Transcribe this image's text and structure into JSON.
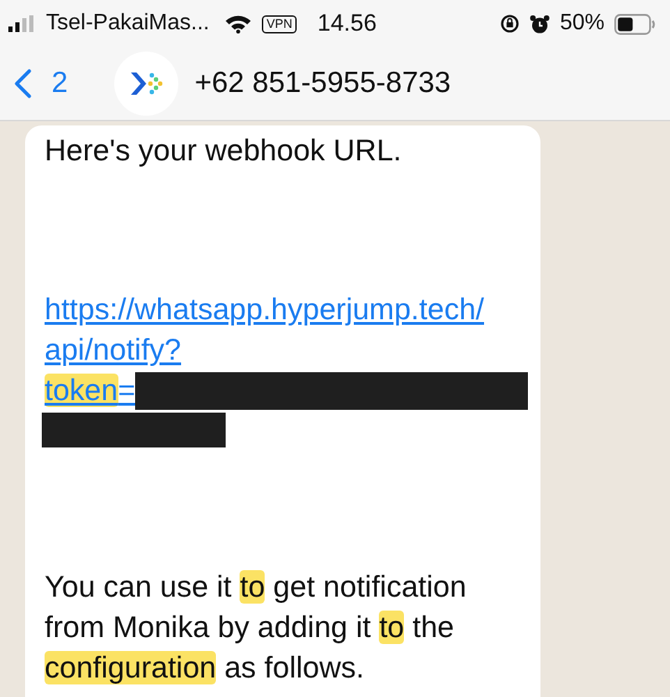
{
  "status_bar": {
    "carrier": "Tsel-PakaiMas...",
    "vpn": "VPN",
    "time": "14.56",
    "battery": "50%"
  },
  "header": {
    "back_count": "2",
    "title": "+62 851-5955-8733"
  },
  "message": {
    "paragraphs": [
      {
        "kind": "text",
        "segments": [
          {
            "text": "Here's your webhook URL.",
            "highlighted": false
          }
        ]
      },
      {
        "kind": "link",
        "lines": [
          [
            {
              "text": "https://whatsapp.hyperjump.tech/",
              "highlighted": false
            }
          ],
          [
            {
              "text": "api/notify?",
              "highlighted": false
            }
          ],
          [
            {
              "text": "token",
              "highlighted": true
            },
            {
              "text": "=",
              "highlighted": false
            }
          ]
        ]
      },
      {
        "kind": "text",
        "segments": [
          {
            "text": "You can use it ",
            "highlighted": false
          },
          {
            "text": "to",
            "highlighted": true
          },
          {
            "text": " get notification from Monika by adding it ",
            "highlighted": false
          },
          {
            "text": "to",
            "highlighted": true
          },
          {
            "text": " the ",
            "highlighted": false
          },
          {
            "text": "configuration",
            "highlighted": true
          },
          {
            "text": " as follows.",
            "highlighted": false
          }
        ]
      }
    ]
  }
}
